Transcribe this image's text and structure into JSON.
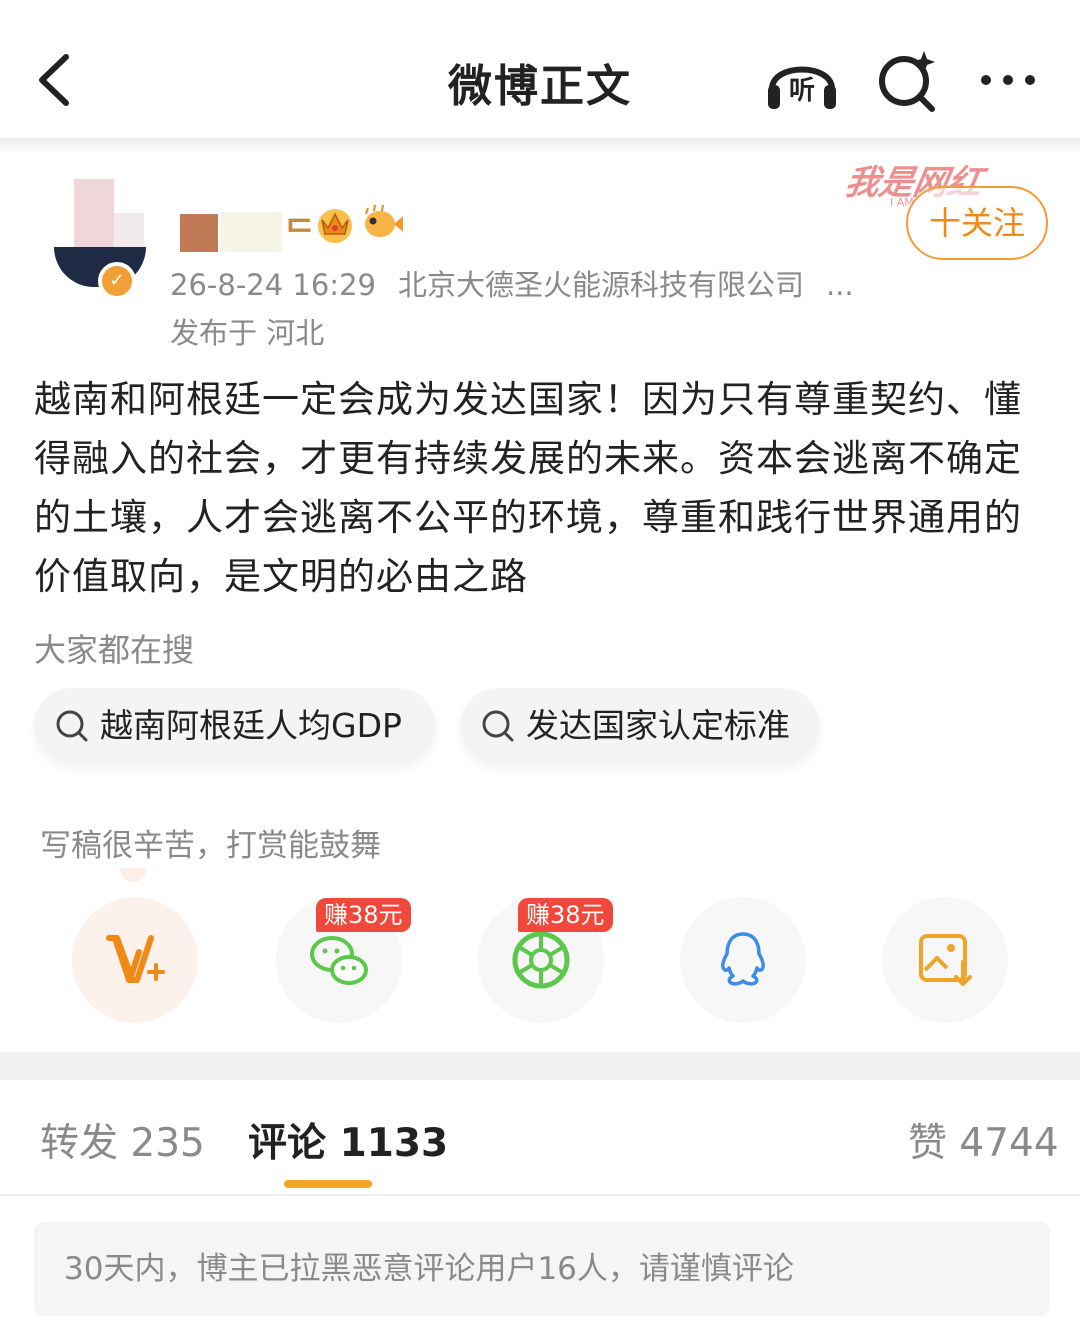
{
  "header": {
    "title": "微博正文",
    "listen_icon_text": "听",
    "back_icon": "back-chevron-icon",
    "listen_icon": "headphones-listen-icon",
    "search_icon": "search-sparkle-icon",
    "more_icon": "more-dots-icon"
  },
  "author": {
    "name_tail": "ᄃ",
    "verified_icon": "verified-badge-icon",
    "badges": [
      "crown-badge-icon",
      "pufferfish-badge-icon"
    ],
    "follow_label": "十关注",
    "date": "26-8-24 16:29",
    "source": "北京大德圣火能源科技有限公司",
    "source_more": "...",
    "location": "发布于 河北"
  },
  "watermark": {
    "text": "我是网红",
    "sub": "I AM"
  },
  "post": {
    "text": "越南和阿根廷一定会成为发达国家！因为只有尊重契约、懂得融入的社会，才更有持续发展的未来。资本会逃离不确定的土壤，人才会逃离不公平的环境，尊重和践行世界通用的价值取向，是文明的必由之路"
  },
  "hot_search": {
    "label": "大家都在搜",
    "items": [
      "越南阿根廷人均GDP",
      "发达国家认定标准"
    ]
  },
  "reward": {
    "tip": "写稿很辛苦，打赏能鼓舞",
    "share_items": [
      {
        "icon": "v-plus-reward-icon"
      },
      {
        "icon": "wechat-icon",
        "badge": "赚38元"
      },
      {
        "icon": "moments-icon",
        "badge": "赚38元"
      },
      {
        "icon": "qq-icon"
      },
      {
        "icon": "save-image-icon"
      }
    ]
  },
  "tabs": {
    "repost": "转发 235",
    "comment": "评论 1133",
    "like": "赞 4744",
    "active": "comment"
  },
  "notice": {
    "text": "30天内，博主已拉黑恶意评论用户16人，请谨慎评论"
  },
  "colors": {
    "accent_orange": "#f08a16",
    "tab_indicator": "#f5a524",
    "earn_badge": "#f0483a",
    "wechat_green": "#5ac84b",
    "qq_blue": "#3d8de8",
    "reward_orange": "#f08a16"
  }
}
